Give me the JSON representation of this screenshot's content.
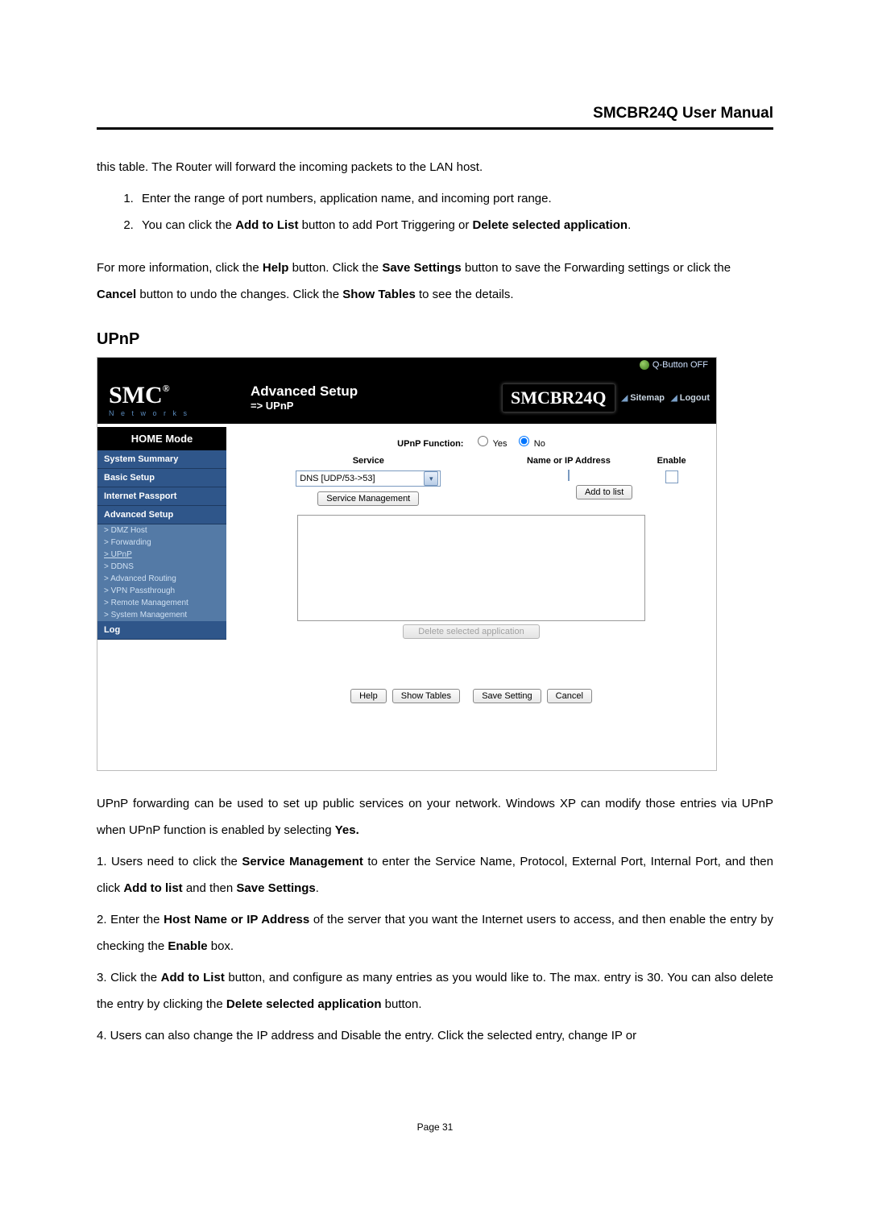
{
  "header": {
    "manual_title": "SMCBR24Q User Manual"
  },
  "section_a": {
    "intro": "this table. The Router will forward the incoming packets to the LAN host.",
    "steps": [
      "Enter the range of port numbers, application name, and incoming port range.",
      "You can click the Add to List button to add Port Triggering or Delete selected application."
    ],
    "followup_1a": "For more information, click the ",
    "followup_1b": "Help",
    "followup_1c": " button. Click the ",
    "followup_1d": "Save Settings",
    "followup_1e": " button to save the Forwarding settings or click the ",
    "followup_1f": "Cancel",
    "followup_1g": " button to undo the changes. Click the ",
    "followup_1h": "Show Tables",
    "followup_1i": " to see the details."
  },
  "section_heading": "UPnP",
  "router": {
    "logo_main": "SMC",
    "logo_reg": "®",
    "logo_sub": "N e t w o r k s",
    "title": "Advanced Setup",
    "breadcrumb": "=> UPnP",
    "model": "SMCBR24Q",
    "sitemap": "Sitemap",
    "logout": "Logout",
    "qbutton": "Q-Button OFF",
    "sidebar": {
      "home": "HOME Mode",
      "items": [
        "System Summary",
        "Basic Setup",
        "Internet Passport",
        "Advanced Setup"
      ],
      "sub": [
        "> DMZ Host",
        "> Forwarding",
        "> UPnP",
        "> DDNS",
        "> Advanced Routing",
        "> VPN Passthrough",
        "> Remote Management",
        "> System Management"
      ],
      "log": "Log"
    },
    "main": {
      "upnp_label": "UPnP Function:",
      "yes": "Yes",
      "no": "No",
      "th_service": "Service",
      "th_name": "Name or IP Address",
      "th_enable": "Enable",
      "service_value": "DNS [UDP/53->53]",
      "svc_mgmt_btn": "Service Management",
      "add_btn": "Add to list",
      "delete_btn": "Delete selected application",
      "help_btn": "Help",
      "show_tables_btn": "Show Tables",
      "save_btn": "Save Setting",
      "cancel_btn": "Cancel"
    }
  },
  "section_b": {
    "p1a": "UPnP forwarding can be used to set up public services on your network. Windows XP can modify those entries via UPnP when UPnP function is enabled by selecting ",
    "p1b": "Yes.",
    "p2a": "1.  Users need to click the ",
    "p2b": "Service Management",
    "p2c": " to enter the Service Name, Protocol, External Port, Internal Port, and then click ",
    "p2d": "Add to list",
    "p2e": " and then ",
    "p2f": "Save Settings",
    "p2g": ".",
    "p3a": "2.  Enter the ",
    "p3b": "Host Name or IP Address",
    "p3c": " of the server that you want the Internet users to access, and then enable the entry by checking the ",
    "p3d": "Enable",
    "p3e": " box.",
    "p4a": "3.  Click the ",
    "p4b": "Add to List",
    "p4c": " button, and configure as many entries as you would like to. The max. entry is 30. You can also delete the entry by clicking the ",
    "p4d": "Delete selected application",
    "p4e": " button.",
    "p5": "4.  Users can also change the IP address and Disable the entry. Click the selected entry, change IP or"
  },
  "footer": {
    "page": "Page 31"
  }
}
